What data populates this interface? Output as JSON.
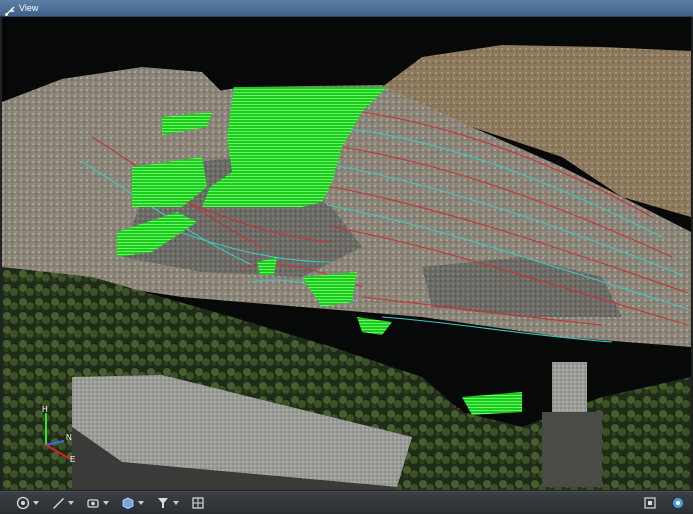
{
  "window": {
    "title": "View"
  },
  "axis": {
    "up": "H",
    "north": "N",
    "east": "E"
  },
  "toolbar": {
    "left": [
      {
        "icon": "render-mode-icon",
        "dropdown": true
      },
      {
        "icon": "brush-icon",
        "dropdown": true
      },
      {
        "icon": "camera-icon",
        "dropdown": true
      },
      {
        "icon": "cube-view-icon",
        "dropdown": true
      },
      {
        "icon": "filter-icon",
        "dropdown": true
      },
      {
        "icon": "grid-select-icon",
        "dropdown": false
      }
    ],
    "right": [
      {
        "icon": "fit-view-icon"
      },
      {
        "icon": "screenshot-icon"
      }
    ]
  },
  "colors": {
    "titlebar": "#4d7099",
    "selection": "#2ee62e",
    "contour_red": "#c83232",
    "contour_cyan": "#3cc8c0",
    "sky": "#070808"
  }
}
